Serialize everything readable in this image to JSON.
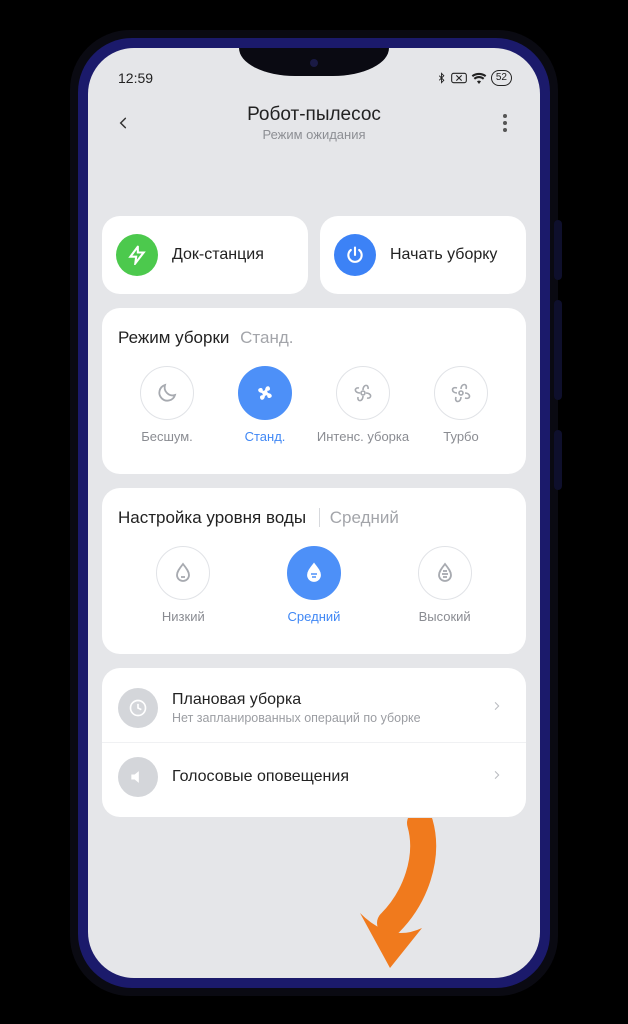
{
  "status": {
    "time": "12:59",
    "battery": "52"
  },
  "header": {
    "title": "Робот-пылесос",
    "subtitle": "Режим ожидания"
  },
  "actions": {
    "dock": "Док-станция",
    "start": "Начать уборку"
  },
  "cleaning_mode": {
    "title": "Режим уборки",
    "current": "Станд.",
    "options": [
      "Бесшум.",
      "Станд.",
      "Интенс. уборка",
      "Турбо"
    ]
  },
  "water_level": {
    "title": "Настройка уровня воды",
    "current": "Средний",
    "options": [
      "Низкий",
      "Средний",
      "Высокий"
    ]
  },
  "list": {
    "scheduled": {
      "title": "Плановая уборка",
      "sub": "Нет запланированных операций по уборке"
    },
    "voice": {
      "title": "Голосовые оповещения"
    }
  }
}
